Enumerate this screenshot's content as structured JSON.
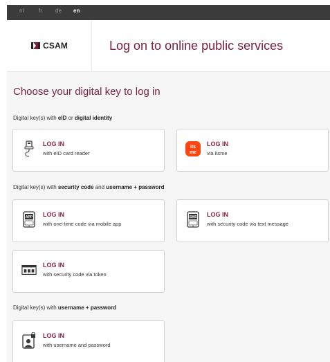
{
  "languages": [
    "nl",
    "fr",
    "de",
    "en"
  ],
  "active_language": "en",
  "header": {
    "logo_text": "CSAM",
    "title": "Log on to online public services"
  },
  "main": {
    "title": "Choose your digital key to log in",
    "section1": {
      "prefix": "Digital key(s) with ",
      "b1": "eID",
      "mid": " or ",
      "b2": "digital identity"
    },
    "section2": {
      "prefix": "Digital key(s) with ",
      "b1": "security code",
      "mid": " and ",
      "b2": "username + password"
    },
    "section3": {
      "prefix": "Digital key(s) with ",
      "b1": "username + password"
    }
  },
  "cards": {
    "eid": {
      "title": "LOG IN",
      "sub": "with eID card reader",
      "icon": "card-reader-icon"
    },
    "itsme": {
      "title": "LOG IN",
      "sub": "via itsme",
      "icon": "itsme-icon",
      "icon_text": "its me",
      "color": "#ff4612"
    },
    "app": {
      "title": "LOG IN",
      "sub": "with one-time code via mobile app",
      "icon": "mobile-app-icon",
      "icon_text": "APP"
    },
    "sms": {
      "title": "LOG IN",
      "sub": "with security code via text message",
      "icon": "sms-icon",
      "icon_text": "SMS"
    },
    "token": {
      "title": "LOG IN",
      "sub": "with security code via token",
      "icon": "token-icon"
    },
    "userpass": {
      "title": "LOG IN",
      "sub": "with username and password",
      "icon": "user-lock-icon"
    }
  },
  "colors": {
    "accent": "#7a1f3a",
    "itsme": "#ff4612",
    "langbar": "#3b3b3b"
  }
}
